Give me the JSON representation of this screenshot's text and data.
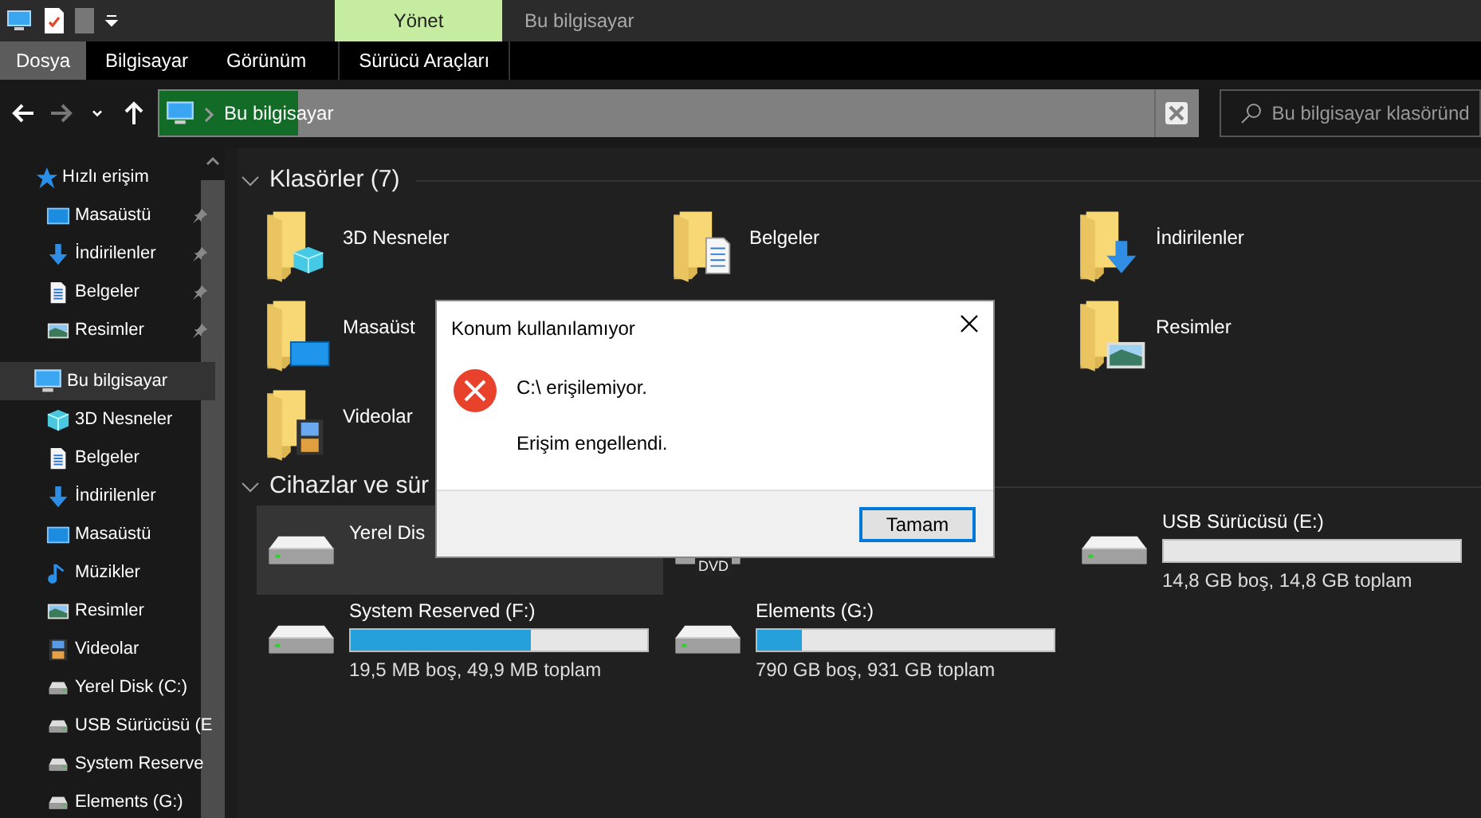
{
  "title_bar": {
    "quick_access": [
      {
        "kind": "computer"
      },
      {
        "kind": "properties"
      },
      {
        "kind": "newfolder"
      },
      {
        "kind": "customize"
      }
    ],
    "context_header": "Yönet",
    "title": "Bu bilgisayar"
  },
  "ribbon": {
    "tabs": [
      {
        "label": "Dosya",
        "kind": "file"
      },
      {
        "label": "Bilgisayar",
        "kind": "tab"
      },
      {
        "label": "Görünüm",
        "kind": "tab"
      },
      {
        "label": "Sürücü Araçları",
        "kind": "contextual"
      }
    ]
  },
  "nav": {
    "buttons": [
      {
        "kind": "back",
        "disabled": false
      },
      {
        "kind": "forward",
        "disabled": true
      },
      {
        "kind": "recent",
        "disabled": false
      },
      {
        "kind": "up",
        "disabled": false
      }
    ],
    "address": {
      "text": "Bu bilgisayar",
      "level": 0.14
    },
    "search": {
      "placeholder": "Bu bilgisayar klasöründ"
    }
  },
  "sidebar": {
    "items": [
      {
        "label": "Hızlı erişim",
        "kind": "star",
        "selected": false,
        "children": [
          {
            "label": "Masaüstü",
            "kind": "desktop",
            "selected": false,
            "pinned": true
          },
          {
            "label": "İndirilenler",
            "kind": "download",
            "selected": false,
            "pinned": true
          },
          {
            "label": "Belgeler",
            "kind": "document",
            "selected": false,
            "pinned": true
          },
          {
            "label": "Resimler",
            "kind": "picture",
            "selected": false,
            "pinned": true
          }
        ]
      },
      {
        "label": "Bu bilgisayar",
        "kind": "computer",
        "selected": true,
        "children": [
          {
            "label": "3D Nesneler",
            "kind": "cube",
            "selected": false
          },
          {
            "label": "Belgeler",
            "kind": "document",
            "selected": false
          },
          {
            "label": "İndirilenler",
            "kind": "download",
            "selected": false
          },
          {
            "label": "Masaüstü",
            "kind": "desktop",
            "selected": false
          },
          {
            "label": "Müzikler",
            "kind": "music",
            "selected": false
          },
          {
            "label": "Resimler",
            "kind": "picture",
            "selected": false
          },
          {
            "label": "Videolar",
            "kind": "video",
            "selected": false
          },
          {
            "label": "Yerel Disk (C:)",
            "kind": "drive",
            "selected": false
          },
          {
            "label": "USB Sürücüsü (E",
            "kind": "drive",
            "selected": false
          },
          {
            "label": "System Reserve",
            "kind": "drive",
            "selected": false
          },
          {
            "label": "Elements (G:)",
            "kind": "drive",
            "selected": false
          }
        ]
      }
    ]
  },
  "folders": {
    "heading": "Klasörler (7)",
    "expanded": true,
    "rows": [
      [
        {
          "label": "3D Nesneler",
          "kind": "cube"
        },
        {
          "label": "Belgeler",
          "kind": "document"
        },
        {
          "label": "İndirilenler",
          "kind": "download"
        }
      ],
      [
        {
          "label": "Masaüst",
          "kind": "desktop"
        },
        null,
        {
          "label": "Resimler",
          "kind": "picture"
        }
      ],
      [
        {
          "label": "Videolar",
          "kind": "video"
        }
      ]
    ]
  },
  "drives": {
    "heading": "Cihazlar ve sür",
    "expanded": true,
    "rows": [
      [
        {
          "label": "Yerel Dis",
          "selected": true
        },
        {
          "badge": "DVD",
          "selected": false
        },
        {
          "label": "USB Sürücüsü (E:)",
          "selected": false,
          "level": 0,
          "info": "14,8 GB boş, 14,8 GB toplam"
        }
      ],
      [
        {
          "label": "System Reserved (F:)",
          "selected": false,
          "level": 0.61,
          "info": "19,5 MB boş, 49,9 MB toplam"
        },
        {
          "label": "Elements (G:)",
          "selected": false,
          "level": 0.15,
          "info": "790 GB boş, 931 GB toplam"
        }
      ]
    ]
  },
  "dialog": {
    "title": "Konum kullanılamıyor",
    "kind": "error",
    "messages": [
      "C:\\ erişilemiyor.",
      "Erişim engellendi."
    ],
    "button": {
      "label": "Tamam",
      "focused": true
    }
  }
}
